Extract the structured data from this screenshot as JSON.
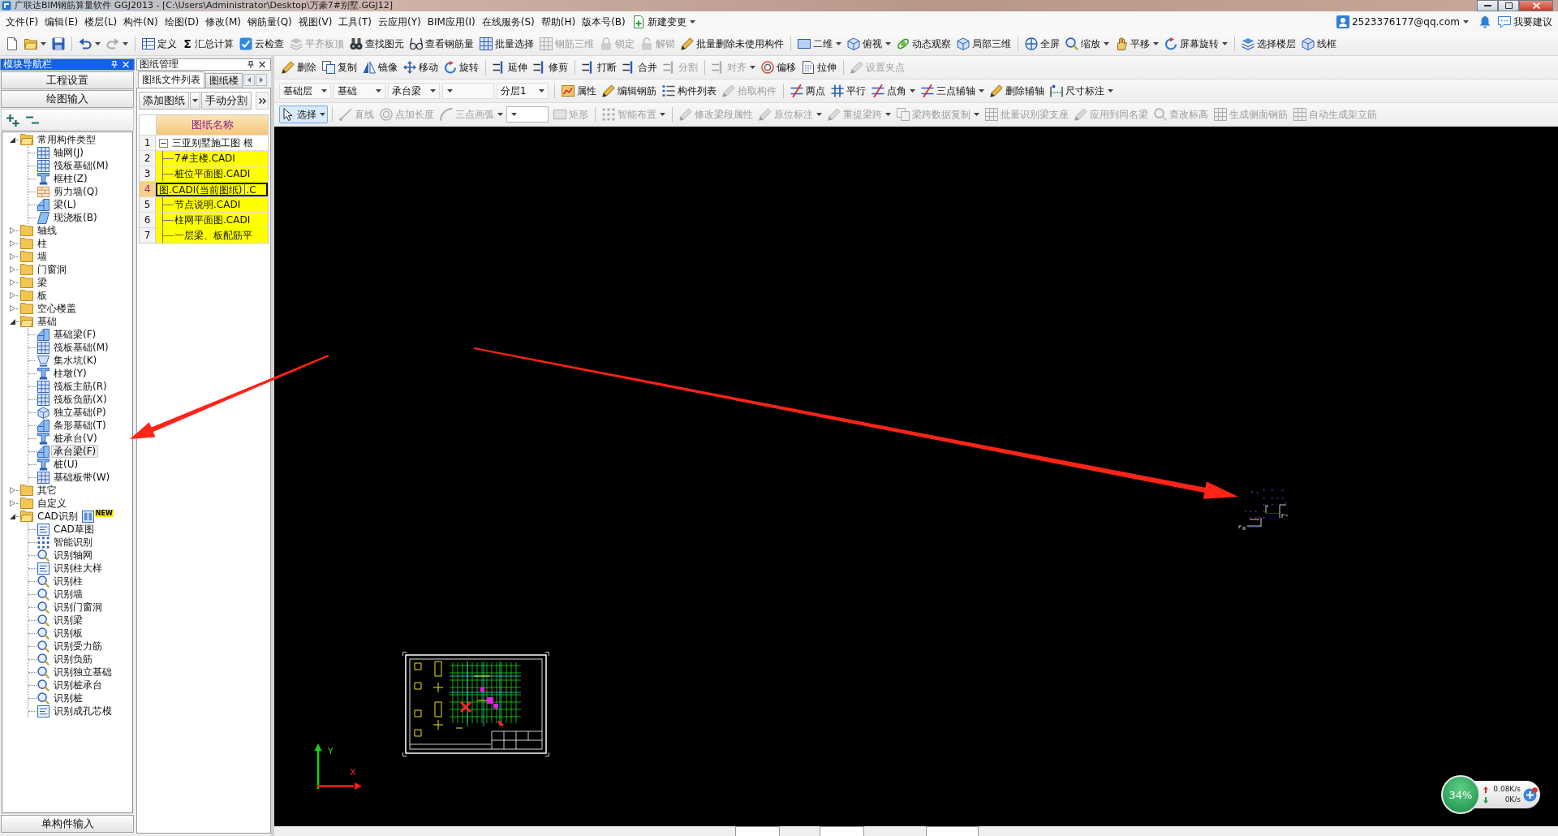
{
  "window": {
    "title": "广联达BIM钢筋算量软件 GGJ2013 - [C:\\Users\\Administrator\\Desktop\\万豪7#别墅.GGJ12]"
  },
  "menu": {
    "items": [
      {
        "label": "文件(F)",
        "kind": "menu"
      },
      {
        "label": "编辑(E)",
        "kind": "menu"
      },
      {
        "label": "楼层(L)",
        "kind": "menu"
      },
      {
        "label": "构件(N)",
        "kind": "menu"
      },
      {
        "label": "绘图(D)",
        "kind": "menu"
      },
      {
        "label": "修改(M)",
        "kind": "menu"
      },
      {
        "label": "钢筋量(Q)",
        "kind": "menu"
      },
      {
        "label": "视图(V)",
        "kind": "menu"
      },
      {
        "label": "工具(T)",
        "kind": "menu"
      },
      {
        "label": "云应用(Y)",
        "kind": "menu"
      },
      {
        "label": "BIM应用(I)",
        "kind": "menu"
      },
      {
        "label": "在线服务(S)",
        "kind": "menu"
      },
      {
        "label": "帮助(H)",
        "kind": "menu"
      },
      {
        "label": "版本号(B)",
        "kind": "menu"
      },
      {
        "label": "新建变更",
        "kind": "action"
      }
    ],
    "account": "2523376177@qq.com",
    "feedback": "我要建议"
  },
  "toolbar": {
    "groups": [
      [
        {
          "kind": "button",
          "disabled": false,
          "dropdown": false
        },
        {
          "kind": "button",
          "disabled": false,
          "dropdown": true
        },
        {
          "kind": "button",
          "disabled": false,
          "dropdown": false
        }
      ],
      [
        {
          "kind": "button",
          "disabled": false,
          "dropdown": true
        },
        {
          "kind": "button",
          "disabled": true,
          "dropdown": true
        }
      ],
      [
        {
          "kind": "button",
          "label": "定义",
          "disabled": false,
          "dropdown": false
        },
        {
          "kind": "button",
          "glyph": "Σ",
          "label": "汇总计算",
          "disabled": false,
          "dropdown": false
        },
        {
          "kind": "button",
          "label": "云检查",
          "disabled": false,
          "dropdown": false
        },
        {
          "kind": "button",
          "label": "平齐板顶",
          "disabled": true,
          "dropdown": false
        },
        {
          "kind": "button",
          "label": "查找图元",
          "disabled": false,
          "dropdown": false
        },
        {
          "kind": "button",
          "label": "查看钢筋量",
          "disabled": false,
          "dropdown": false
        },
        {
          "kind": "button",
          "label": "批量选择",
          "disabled": false,
          "dropdown": false
        },
        {
          "kind": "button",
          "label": "钢筋三维",
          "disabled": true,
          "dropdown": false
        },
        {
          "kind": "button",
          "label": "锁定",
          "disabled": true,
          "dropdown": false
        },
        {
          "kind": "button",
          "label": "解锁",
          "disabled": true,
          "dropdown": false
        },
        {
          "kind": "button",
          "label": "批量删除未使用构件",
          "disabled": false,
          "dropdown": false
        }
      ],
      [
        {
          "kind": "button",
          "label": "二维",
          "disabled": false,
          "dropdown": true
        },
        {
          "kind": "button",
          "label": "俯视",
          "disabled": false,
          "dropdown": true
        },
        {
          "kind": "button",
          "label": "动态观察",
          "disabled": false,
          "dropdown": false
        },
        {
          "kind": "button",
          "label": "局部三维",
          "disabled": false,
          "dropdown": false
        }
      ],
      [
        {
          "kind": "button",
          "label": "全屏",
          "disabled": false,
          "dropdown": false
        },
        {
          "kind": "button",
          "label": "缩放",
          "disabled": false,
          "dropdown": true
        },
        {
          "kind": "button",
          "label": "平移",
          "disabled": false,
          "dropdown": true
        },
        {
          "kind": "button",
          "label": "屏幕旋转",
          "disabled": false,
          "dropdown": true
        }
      ],
      [
        {
          "kind": "button",
          "label": "选择楼层",
          "disabled": false,
          "dropdown": false
        },
        {
          "kind": "button",
          "label": "线框",
          "disabled": false,
          "dropdown": false
        }
      ]
    ]
  },
  "module_nav": {
    "title": "模块导航栏",
    "active": true,
    "buttons": [
      "工程设置",
      "绘图输入"
    ],
    "tree": [
      {
        "label": "常用构件类型",
        "expanded": true,
        "selected": false,
        "children": [
          {
            "label": "轴网(J)",
            "selected": false
          },
          {
            "label": "筏板基础(M)",
            "selected": false
          },
          {
            "label": "框柱(Z)",
            "selected": false
          },
          {
            "label": "剪力墙(Q)",
            "selected": false
          },
          {
            "label": "梁(L)",
            "selected": false
          },
          {
            "label": "现浇板(B)",
            "selected": false
          }
        ]
      },
      {
        "label": "轴线",
        "expanded": false,
        "selected": false
      },
      {
        "label": "柱",
        "expanded": false,
        "selected": false
      },
      {
        "label": "墙",
        "expanded": false,
        "selected": false
      },
      {
        "label": "门窗洞",
        "expanded": false,
        "selected": false
      },
      {
        "label": "梁",
        "expanded": false,
        "selected": false
      },
      {
        "label": "板",
        "expanded": false,
        "selected": false
      },
      {
        "label": "空心楼盖",
        "expanded": false,
        "selected": false
      },
      {
        "label": "基础",
        "expanded": true,
        "selected": false,
        "children": [
          {
            "label": "基础梁(F)",
            "selected": false
          },
          {
            "label": "筏板基础(M)",
            "selected": false
          },
          {
            "label": "集水坑(K)",
            "selected": false
          },
          {
            "label": "柱墩(Y)",
            "selected": false
          },
          {
            "label": "筏板主筋(R)",
            "selected": false
          },
          {
            "label": "筏板负筋(X)",
            "selected": false
          },
          {
            "label": "独立基础(P)",
            "selected": false
          },
          {
            "label": "条形基础(T)",
            "selected": false
          },
          {
            "label": "桩承台(V)",
            "selected": false
          },
          {
            "label": "承台梁(F)",
            "selected": true
          },
          {
            "label": "桩(U)",
            "selected": false
          },
          {
            "label": "基础板带(W)",
            "selected": false
          }
        ]
      },
      {
        "label": "其它",
        "expanded": false,
        "selected": false
      },
      {
        "label": "自定义",
        "expanded": false,
        "selected": false
      },
      {
        "label": "CAD识别",
        "expanded": true,
        "selected": false,
        "badge": "NEW",
        "children": [
          {
            "label": "CAD草图",
            "selected": false
          },
          {
            "label": "智能识别",
            "selected": false
          },
          {
            "label": "识别轴网",
            "selected": false
          },
          {
            "label": "识别柱大样",
            "selected": false
          },
          {
            "label": "识别柱",
            "selected": false
          },
          {
            "label": "识别墙",
            "selected": false
          },
          {
            "label": "识别门窗洞",
            "selected": false
          },
          {
            "label": "识别梁",
            "selected": false
          },
          {
            "label": "识别板",
            "selected": false
          },
          {
            "label": "识别受力筋",
            "selected": false
          },
          {
            "label": "识别负筋",
            "selected": false
          },
          {
            "label": "识别独立基础",
            "selected": false
          },
          {
            "label": "识别桩承台",
            "selected": false
          },
          {
            "label": "识别桩",
            "selected": false
          },
          {
            "label": "识别成孔芯模",
            "selected": false
          }
        ]
      }
    ],
    "footer_button": "单构件输入"
  },
  "drawing_manager": {
    "title": "图纸管理",
    "active": false,
    "tabs": [
      {
        "label": "图纸文件列表",
        "selected": true
      },
      {
        "label": "图纸楼",
        "selected": false
      }
    ],
    "buttons": [
      {
        "label": "添加图纸",
        "dropdown": true
      },
      {
        "label": "手动分割",
        "dropdown": false
      }
    ],
    "table": {
      "columns": [
        "图纸名称"
      ],
      "rows": [
        {
          "number": "1",
          "name": "三亚别墅施工图 根",
          "kind": "parent",
          "expanded": true,
          "selected": false,
          "editing": false
        },
        {
          "number": "2",
          "name": "7#主楼.CADI",
          "kind": "child",
          "selected": false,
          "editing": false
        },
        {
          "number": "3",
          "name": "桩位平面图.CADI",
          "kind": "child",
          "selected": false,
          "editing": false
        },
        {
          "number": "4",
          "name": "图.CADI(当前图纸)",
          "tail": ".C",
          "kind": "child",
          "selected": true,
          "editing": true
        },
        {
          "number": "5",
          "name": "节点说明.CADI",
          "kind": "child",
          "selected": false,
          "editing": false
        },
        {
          "number": "6",
          "name": "柱网平面图.CADI",
          "kind": "child",
          "selected": false,
          "editing": false
        },
        {
          "number": "7",
          "name": "一层梁、板配筋平",
          "kind": "child",
          "selected": false,
          "editing": false
        }
      ]
    }
  },
  "edit_toolbar": {
    "groups": [
      [
        {
          "kind": "button",
          "label": "删除",
          "disabled": false,
          "dropdown": false
        },
        {
          "kind": "button",
          "label": "复制",
          "disabled": false,
          "dropdown": false
        },
        {
          "kind": "button",
          "label": "镜像",
          "disabled": false,
          "dropdown": false
        },
        {
          "kind": "button",
          "label": "移动",
          "disabled": false,
          "dropdown": false
        },
        {
          "kind": "button",
          "label": "旋转",
          "disabled": false,
          "dropdown": false
        }
      ],
      [
        {
          "kind": "button",
          "label": "延伸",
          "disabled": false,
          "dropdown": false
        },
        {
          "kind": "button",
          "label": "修剪",
          "disabled": false,
          "dropdown": false
        }
      ],
      [
        {
          "kind": "button",
          "label": "打断",
          "disabled": false,
          "dropdown": false
        },
        {
          "kind": "button",
          "label": "合并",
          "disabled": false,
          "dropdown": false
        },
        {
          "kind": "button",
          "label": "分割",
          "disabled": true,
          "dropdown": false
        }
      ],
      [
        {
          "kind": "button",
          "label": "对齐",
          "disabled": true,
          "dropdown": true
        },
        {
          "kind": "button",
          "label": "偏移",
          "disabled": false,
          "dropdown": false
        },
        {
          "kind": "button",
          "label": "拉伸",
          "disabled": false,
          "dropdown": false
        }
      ],
      [
        {
          "kind": "button",
          "label": "设置夹点",
          "disabled": true,
          "dropdown": false
        }
      ]
    ]
  },
  "property_toolbar": {
    "groups": [
      [
        {
          "kind": "combo",
          "value": "基础层",
          "disabled": false
        },
        {
          "kind": "combo",
          "value": "基础",
          "disabled": false
        },
        {
          "kind": "combo",
          "value": "承台梁",
          "disabled": false
        },
        {
          "kind": "combo",
          "disabled": false
        },
        {
          "kind": "combo",
          "value": "分层1",
          "disabled": false
        }
      ],
      [
        {
          "kind": "button",
          "label": "属性",
          "disabled": false,
          "dropdown": false
        },
        {
          "kind": "button",
          "label": "编辑钢筋",
          "disabled": false,
          "dropdown": false
        },
        {
          "kind": "button",
          "label": "构件列表",
          "disabled": false,
          "dropdown": false
        },
        {
          "kind": "button",
          "label": "拾取构件",
          "disabled": true,
          "dropdown": false
        }
      ],
      [
        {
          "kind": "button",
          "label": "两点",
          "disabled": false,
          "dropdown": false
        },
        {
          "kind": "button",
          "label": "平行",
          "disabled": false,
          "dropdown": false
        },
        {
          "kind": "button",
          "label": "点角",
          "disabled": false,
          "dropdown": true
        },
        {
          "kind": "button",
          "label": "三点辅轴",
          "disabled": false,
          "dropdown": true
        },
        {
          "kind": "button",
          "label": "删除辅轴",
          "disabled": false,
          "dropdown": false
        },
        {
          "kind": "button",
          "label": "尺寸标注",
          "disabled": false,
          "dropdown": true
        }
      ]
    ]
  },
  "draw_toolbar": {
    "groups": [
      [
        {
          "kind": "button",
          "label": "选择",
          "disabled": false,
          "dropdown": true,
          "selected": true
        }
      ],
      [
        {
          "kind": "button",
          "label": "直线",
          "disabled": true,
          "dropdown": false,
          "selected": false
        },
        {
          "kind": "button",
          "label": "点加长度",
          "disabled": true,
          "dropdown": false,
          "selected": false
        },
        {
          "kind": "button",
          "label": "三点画弧",
          "disabled": true,
          "dropdown": true,
          "selected": false
        },
        {
          "kind": "combo",
          "disabled": false
        },
        {
          "kind": "button",
          "label": "矩形",
          "disabled": true,
          "dropdown": false,
          "selected": false
        }
      ],
      [
        {
          "kind": "button",
          "label": "智能布置",
          "disabled": true,
          "dropdown": true,
          "selected": false
        }
      ],
      [
        {
          "kind": "button",
          "label": "修改梁段属性",
          "disabled": true,
          "dropdown": false,
          "selected": false
        },
        {
          "kind": "button",
          "label": "原位标注",
          "disabled": true,
          "dropdown": true,
          "selected": false
        },
        {
          "kind": "button",
          "label": "重提梁跨",
          "disabled": true,
          "dropdown": true,
          "selected": false
        },
        {
          "kind": "button",
          "label": "梁跨数据复制",
          "disabled": true,
          "dropdown": true,
          "selected": false
        },
        {
          "kind": "button",
          "label": "批量识别梁支座",
          "disabled": true,
          "dropdown": false,
          "selected": false
        },
        {
          "kind": "button",
          "label": "应用到同名梁",
          "disabled": true,
          "dropdown": false,
          "selected": false
        },
        {
          "kind": "button",
          "label": "查改标高",
          "disabled": true,
          "dropdown": false,
          "selected": false
        },
        {
          "kind": "button",
          "label": "生成侧面钢筋",
          "disabled": true,
          "dropdown": false,
          "selected": false
        },
        {
          "kind": "button",
          "label": "自动生成架立筋",
          "disabled": true,
          "dropdown": false,
          "selected": false
        }
      ]
    ]
  },
  "canvas": {
    "axis": {
      "x_label": "X",
      "y_label": "Y"
    },
    "network_monitor": {
      "usage": "34%",
      "upload": "0.08K/s",
      "download": "0K/s"
    }
  }
}
